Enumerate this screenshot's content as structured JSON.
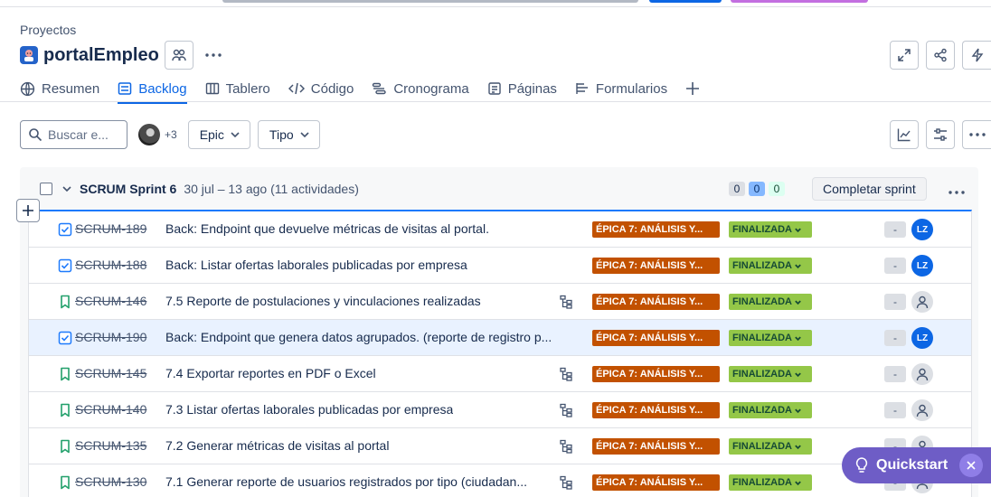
{
  "breadcrumb": "Proyectos",
  "project": {
    "title": "portalEmpleo"
  },
  "tabs": [
    {
      "label": "Resumen"
    },
    {
      "label": "Backlog"
    },
    {
      "label": "Tablero"
    },
    {
      "label": "Código"
    },
    {
      "label": "Cronograma"
    },
    {
      "label": "Páginas"
    },
    {
      "label": "Formularios"
    }
  ],
  "toolbar": {
    "search_placeholder": "Buscar e...",
    "extra_members": "+3",
    "epic_filter": "Epic",
    "type_filter": "Tipo"
  },
  "sprint": {
    "name": "SCRUM Sprint 6",
    "dates": "30 jul – 13 ago (11 actividades)",
    "counts": [
      "0",
      "0",
      "0"
    ],
    "complete_label": "Completar sprint"
  },
  "issues": [
    {
      "key": "SCRUM-189",
      "summary": "Back: Endpoint que devuelve métricas de visitas al portal.",
      "type": "task",
      "epic": "ÉPICA 7: ANÁLISIS Y...",
      "status": "FINALIZADA",
      "estimate": "-",
      "assignee": "LZ",
      "has_child": false,
      "selected": false
    },
    {
      "key": "SCRUM-188",
      "summary": "Back: Listar ofertas laborales publicadas por empresa",
      "type": "task",
      "epic": "ÉPICA 7: ANÁLISIS Y...",
      "status": "FINALIZADA",
      "estimate": "-",
      "assignee": "LZ",
      "has_child": false,
      "selected": false
    },
    {
      "key": "SCRUM-146",
      "summary": "7.5 Reporte de postulaciones y vinculaciones realizadas",
      "type": "story",
      "epic": "ÉPICA 7: ANÁLISIS Y...",
      "status": "FINALIZADA",
      "estimate": "-",
      "assignee": "",
      "has_child": true,
      "selected": false
    },
    {
      "key": "SCRUM-190",
      "summary": "Back: Endpoint que genera datos agrupados. (reporte de registro p...",
      "type": "task",
      "epic": "ÉPICA 7: ANÁLISIS Y...",
      "status": "FINALIZADA",
      "estimate": "-",
      "assignee": "LZ",
      "has_child": false,
      "selected": true
    },
    {
      "key": "SCRUM-145",
      "summary": "7.4 Exportar reportes en PDF o Excel",
      "type": "story",
      "epic": "ÉPICA 7: ANÁLISIS Y...",
      "status": "FINALIZADA",
      "estimate": "-",
      "assignee": "",
      "has_child": true,
      "selected": false
    },
    {
      "key": "SCRUM-140",
      "summary": "7.3 Listar ofertas laborales publicadas por empresa",
      "type": "story",
      "epic": "ÉPICA 7: ANÁLISIS Y...",
      "status": "FINALIZADA",
      "estimate": "-",
      "assignee": "",
      "has_child": true,
      "selected": false
    },
    {
      "key": "SCRUM-135",
      "summary": "7.2 Generar métricas de visitas al portal",
      "type": "story",
      "epic": "ÉPICA 7: ANÁLISIS Y...",
      "status": "FINALIZADA",
      "estimate": "-",
      "assignee": "",
      "has_child": true,
      "selected": false
    },
    {
      "key": "SCRUM-130",
      "summary": "7.1 Generar reporte de usuarios registrados por tipo (ciudadan...",
      "type": "story",
      "epic": "ÉPICA 7: ANÁLISIS Y...",
      "status": "FINALIZADA",
      "estimate": "-",
      "assignee": "",
      "has_child": true,
      "selected": false
    }
  ],
  "quickstart": {
    "label": "Quickstart"
  },
  "colors": {
    "accent": "#0c66e4",
    "epic": "#c25100",
    "status_done": "#94c748",
    "quickstart": "#6e5dc6"
  }
}
